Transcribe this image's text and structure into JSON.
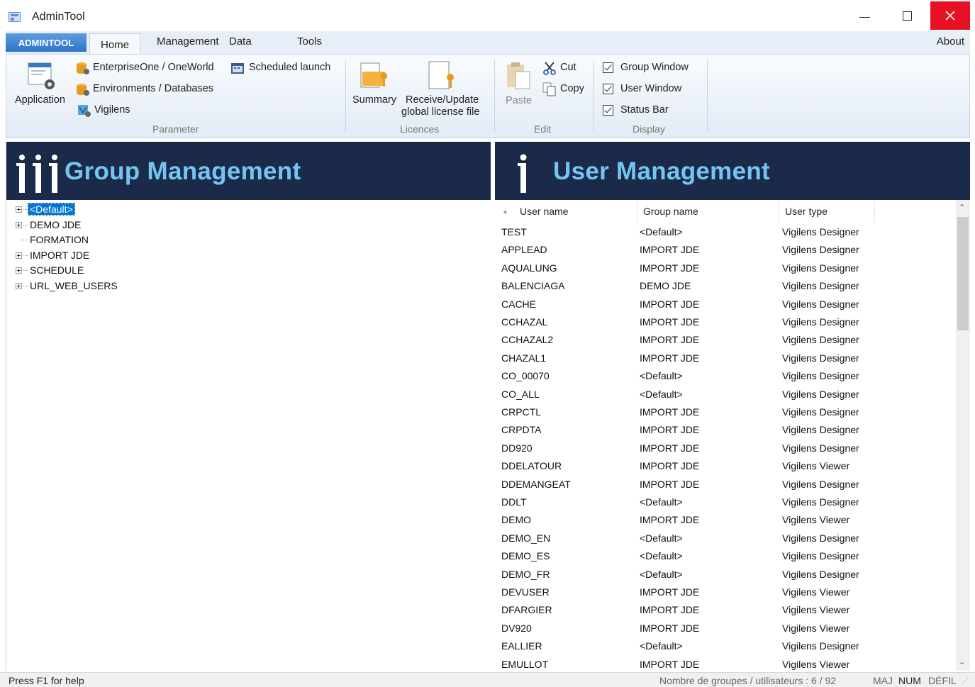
{
  "window": {
    "title": "AdminTool"
  },
  "ribbon": {
    "tabs": {
      "app_tab": "ADMINTOOL",
      "home": "Home",
      "management": "Management",
      "data": "Data",
      "tools": "Tools",
      "about": "About"
    },
    "parameter": {
      "group_label": "Parameter",
      "application": "Application",
      "enterprise": "EnterpriseOne / OneWorld",
      "environments": "Environments / Databases",
      "vigilens": "Vigilens",
      "scheduled": "Scheduled launch"
    },
    "licences": {
      "group_label": "Licences",
      "summary": "Summary",
      "receive_line1": "Receive/Update",
      "receive_line2": "global license file"
    },
    "edit": {
      "group_label": "Edit",
      "paste": "Paste",
      "cut": "Cut",
      "copy": "Copy"
    },
    "display": {
      "group_label": "Display",
      "group_window": "Group Window",
      "user_window": "User Window",
      "status_bar": "Status Bar"
    }
  },
  "group_panel": {
    "title": "Group Management",
    "tree": [
      "<Default>",
      "DEMO JDE",
      "FORMATION",
      "IMPORT JDE",
      "SCHEDULE",
      "URL_WEB_USERS"
    ]
  },
  "user_panel": {
    "title": "User Management",
    "columns": {
      "user": "User name",
      "group": "Group name",
      "type": "User type"
    },
    "rows": [
      [
        "TEST",
        "<Default>",
        "Vigilens Designer"
      ],
      [
        "APPLEAD",
        "IMPORT JDE",
        "Vigilens Designer"
      ],
      [
        "AQUALUNG",
        "IMPORT JDE",
        "Vigilens Designer"
      ],
      [
        "BALENCIAGA",
        "DEMO JDE",
        "Vigilens Designer"
      ],
      [
        "CACHE",
        "IMPORT JDE",
        "Vigilens Designer"
      ],
      [
        "CCHAZAL",
        "IMPORT JDE",
        "Vigilens Designer"
      ],
      [
        "CCHAZAL2",
        "IMPORT JDE",
        "Vigilens Designer"
      ],
      [
        "CHAZAL1",
        "IMPORT JDE",
        "Vigilens Designer"
      ],
      [
        "CO_00070",
        "<Default>",
        "Vigilens Designer"
      ],
      [
        "CO_ALL",
        "<Default>",
        "Vigilens Designer"
      ],
      [
        "CRPCTL",
        "IMPORT JDE",
        "Vigilens Designer"
      ],
      [
        "CRPDTA",
        "IMPORT JDE",
        "Vigilens Designer"
      ],
      [
        "DD920",
        "IMPORT JDE",
        "Vigilens Designer"
      ],
      [
        "DDELATOUR",
        "IMPORT JDE",
        "Vigilens Viewer"
      ],
      [
        "DDEMANGEAT",
        "IMPORT JDE",
        "Vigilens Designer"
      ],
      [
        "DDLT",
        "<Default>",
        "Vigilens Designer"
      ],
      [
        "DEMO",
        "IMPORT JDE",
        "Vigilens Viewer"
      ],
      [
        "DEMO_EN",
        "<Default>",
        "Vigilens Designer"
      ],
      [
        "DEMO_ES",
        "<Default>",
        "Vigilens Designer"
      ],
      [
        "DEMO_FR",
        "<Default>",
        "Vigilens Designer"
      ],
      [
        "DEVUSER",
        "IMPORT JDE",
        "Vigilens Viewer"
      ],
      [
        "DFARGIER",
        "IMPORT JDE",
        "Vigilens Viewer"
      ],
      [
        "DV920",
        "IMPORT JDE",
        "Vigilens Viewer"
      ],
      [
        "EALLIER",
        "<Default>",
        "Vigilens Designer"
      ],
      [
        "EMULLOT",
        "IMPORT JDE",
        "Vigilens Viewer"
      ]
    ]
  },
  "status": {
    "help": "Press F1 for help",
    "counts": "Nombre de groupes / utilisateurs : 6 / 92",
    "maj": "MAJ",
    "num": "NUM",
    "defil": "DÉFIL"
  }
}
